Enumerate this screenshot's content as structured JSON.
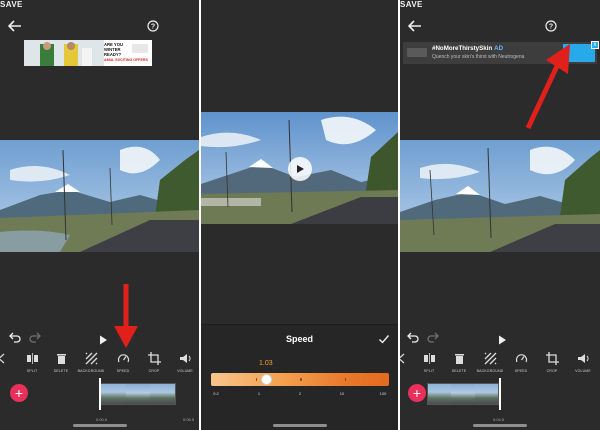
{
  "panel1": {
    "save_label": "SAVE",
    "ad": {
      "headline": "ARE YOU WINTER READY?",
      "offer": "AMUL EXCITING OFFERS"
    },
    "tools": [
      {
        "name": "split",
        "label": "SPLIT",
        "icon": "split-icon"
      },
      {
        "name": "delete",
        "label": "DELETE",
        "icon": "trash-icon"
      },
      {
        "name": "background",
        "label": "BACKGROUND",
        "icon": "background-icon"
      },
      {
        "name": "speed",
        "label": "SPEED",
        "icon": "speedometer-icon"
      },
      {
        "name": "crop",
        "label": "CROP",
        "icon": "crop-icon"
      },
      {
        "name": "volume",
        "label": "VOLUME",
        "icon": "volume-icon"
      }
    ],
    "timeline": {
      "start": "0:00.0",
      "end": "0:05.5"
    }
  },
  "panel2": {
    "sheet_title": "Speed",
    "speed_value": "1.03",
    "speed_fraction": 0.31,
    "scale_labels": [
      "0.2",
      "1",
      "2",
      "10",
      "100"
    ]
  },
  "panel3": {
    "save_label": "SAVE",
    "ad": {
      "headline": "#NoMoreThirstySkin",
      "badge": "AD",
      "subtext": "Quench your skin's thirst with Neutrogena",
      "close_label": "x"
    },
    "tools": [
      {
        "name": "split",
        "label": "SPLIT",
        "icon": "split-icon"
      },
      {
        "name": "delete",
        "label": "DELETE",
        "icon": "trash-icon"
      },
      {
        "name": "background",
        "label": "BACKGROUND",
        "icon": "background-icon"
      },
      {
        "name": "speed",
        "label": "SPEED",
        "icon": "speedometer-icon"
      },
      {
        "name": "crop",
        "label": "CROP",
        "icon": "crop-icon"
      },
      {
        "name": "volume",
        "label": "VOLUME",
        "icon": "volume-icon"
      }
    ],
    "timeline": {
      "end": "0:04.5"
    }
  },
  "colors": {
    "app_background": "#2b2b2b",
    "add_button": "#e8305a",
    "annotation_arrow": "#e0201a",
    "speed_value": "#f2a037",
    "ad_open_button": "#28a9ea"
  }
}
